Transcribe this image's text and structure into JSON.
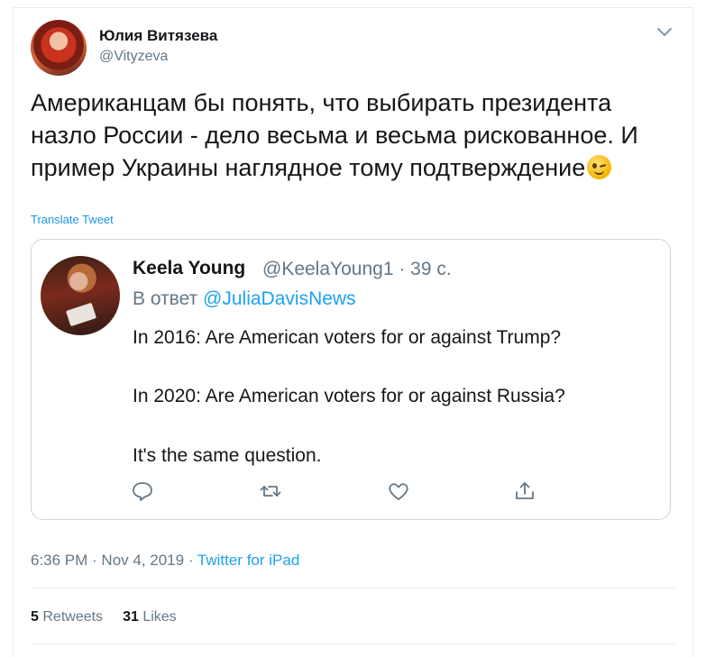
{
  "tweet": {
    "display_name": "Юлия Витязева",
    "handle": "@Vityzeva",
    "text": "Американцам бы понять, что выбирать президента назло России - дело весьма и весьма рискованное. И пример Украины наглядное тому подтверждение",
    "translate_label": "Translate Tweet",
    "menu_icon": "chevron-down-icon"
  },
  "quoted": {
    "display_name": "Keela Young",
    "meta": "@KeelaYoung1 · 39 с.",
    "reply_prefix": "В ответ",
    "reply_mention": "@JuliaDavisNews",
    "lines": [
      "In 2016: Are American voters for or against Trump?",
      "In 2020: Are American voters for or against Russia?",
      "It's the same question."
    ],
    "actions": [
      "reply-icon",
      "retweet-icon",
      "like-icon",
      "share-icon"
    ]
  },
  "footer": {
    "time_date": "6:36 PM · Nov 4, 2019 · ",
    "source": "Twitter for iPad",
    "retweets_count": "5",
    "retweets_label": "Retweets",
    "likes_count": "31",
    "likes_label": "Likes"
  },
  "colors": {
    "link_blue": "#1da1f2",
    "secondary_text": "#657786",
    "border": "#ccd6dd"
  }
}
